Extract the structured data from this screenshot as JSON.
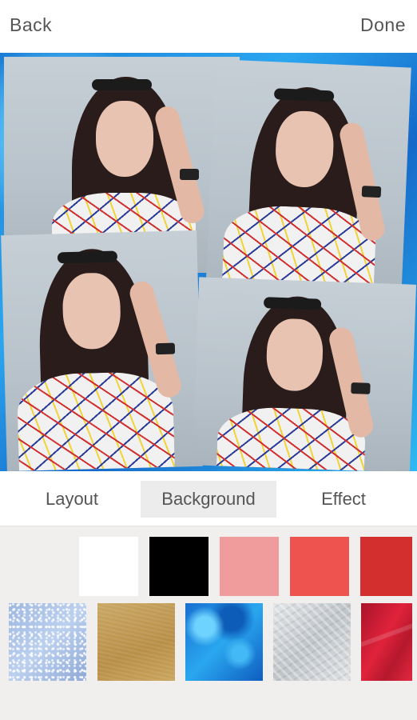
{
  "topbar": {
    "back_label": "Back",
    "done_label": "Done"
  },
  "tabs": [
    {
      "label": "Layout"
    },
    {
      "label": "Background",
      "selected": true
    },
    {
      "label": "Effect"
    }
  ],
  "palette": {
    "solid_colors": [
      "#ffffff",
      "#000000",
      "#f19c9c",
      "#ef5350",
      "#d32f2f"
    ],
    "textures": [
      {
        "name": "light-blue-glitter-texture",
        "color": "#a9c2e6"
      },
      {
        "name": "kraft-paper-texture",
        "color": "#c6a35f"
      },
      {
        "name": "blue-bokeh-texture",
        "color": "#1e8fe3"
      },
      {
        "name": "silver-foil-texture",
        "color": "#cfd3d6"
      },
      {
        "name": "red-abstract-texture",
        "color": "#d21f35"
      }
    ]
  },
  "collage": {
    "background_color": "#1e8fe3",
    "photo_count": 4
  }
}
